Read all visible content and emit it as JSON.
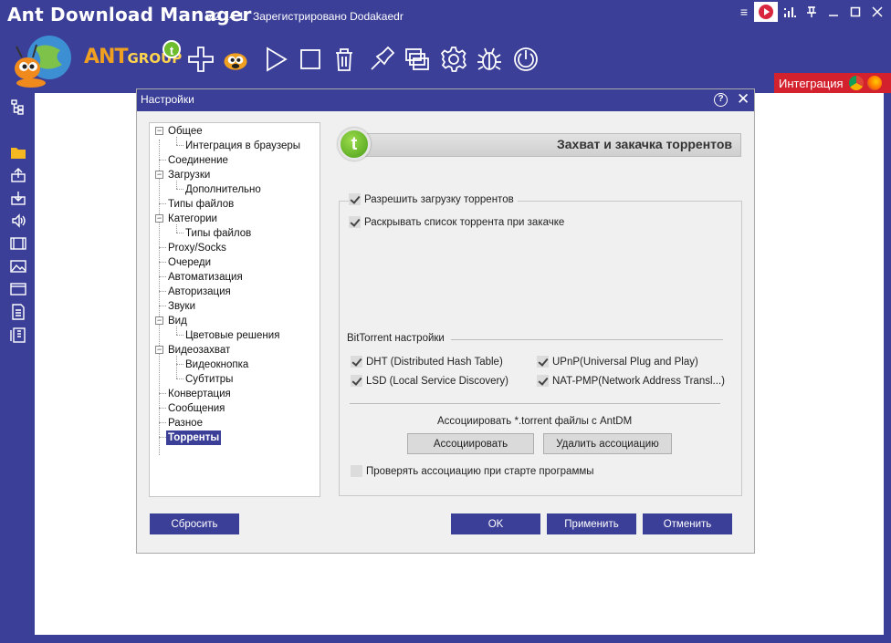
{
  "app": {
    "title": "Ant Download Manager",
    "version": "v.2.14.1",
    "registration": "Зарегистрировано Dodakaedr",
    "brand_main": "ANT",
    "brand_sub": "GROUP"
  },
  "toolbar": {
    "icons": [
      "add-icon",
      "ant-mascot-icon",
      "play-icon",
      "stop-icon",
      "trash-icon",
      "pin-icon",
      "windows-icon",
      "gear-icon",
      "bug-icon",
      "power-icon"
    ]
  },
  "integration": {
    "label": "Интеграция"
  },
  "dialog": {
    "title": "Настройки",
    "help": "?",
    "close": "✕",
    "tree": [
      {
        "label": "Общее"
      },
      {
        "label": "Интеграция в браузеры"
      },
      {
        "label": "Соединение"
      },
      {
        "label": "Загрузки"
      },
      {
        "label": "Дополнительно"
      },
      {
        "label": "Типы файлов"
      },
      {
        "label": "Категории"
      },
      {
        "label": "Типы файлов"
      },
      {
        "label": "Proxy/Socks"
      },
      {
        "label": "Очереди"
      },
      {
        "label": "Автоматизация"
      },
      {
        "label": "Авторизация"
      },
      {
        "label": "Звуки"
      },
      {
        "label": "Вид"
      },
      {
        "label": "Цветовые решения"
      },
      {
        "label": "Видеозахват"
      },
      {
        "label": "Видеокнопка"
      },
      {
        "label": "Субтитры"
      },
      {
        "label": "Конвертация"
      },
      {
        "label": "Сообщения"
      },
      {
        "label": "Разное"
      },
      {
        "label": "Торренты"
      }
    ],
    "panel": {
      "badge": "t",
      "title": "Захват и закачка торрентов",
      "allow_torrents": {
        "label": "Разрешить загрузку торрентов",
        "checked": true
      },
      "expand_list": {
        "label": "Раскрывать список торрента при закачке",
        "checked": true
      },
      "bt_section": "BitTorrent настройки",
      "dht": {
        "label": "DHT (Distributed Hash Table)",
        "checked": true
      },
      "upnp": {
        "label": "UPnP(Universal Plug and Play)",
        "checked": true
      },
      "lsd": {
        "label": "LSD (Local Service Discovery)",
        "checked": true
      },
      "natpmp": {
        "label": "NAT-PMP(Network Address Transl...)",
        "checked": true
      },
      "assoc_text": "Ассоциировать *.torrent файлы с AntDM",
      "assoc_btn": "Ассоциировать",
      "remove_assoc_btn": "Удалить ассоциацию",
      "check_assoc": {
        "label": "Проверять ассоциацию при старте программы",
        "checked": false
      }
    },
    "buttons": {
      "reset": "Сбросить",
      "ok": "OK",
      "apply": "Применить",
      "cancel": "Отменить"
    }
  },
  "colors": {
    "chrome": "#3b3f97",
    "integration": "#d4212e",
    "badge_green": "#6dbd2e"
  }
}
